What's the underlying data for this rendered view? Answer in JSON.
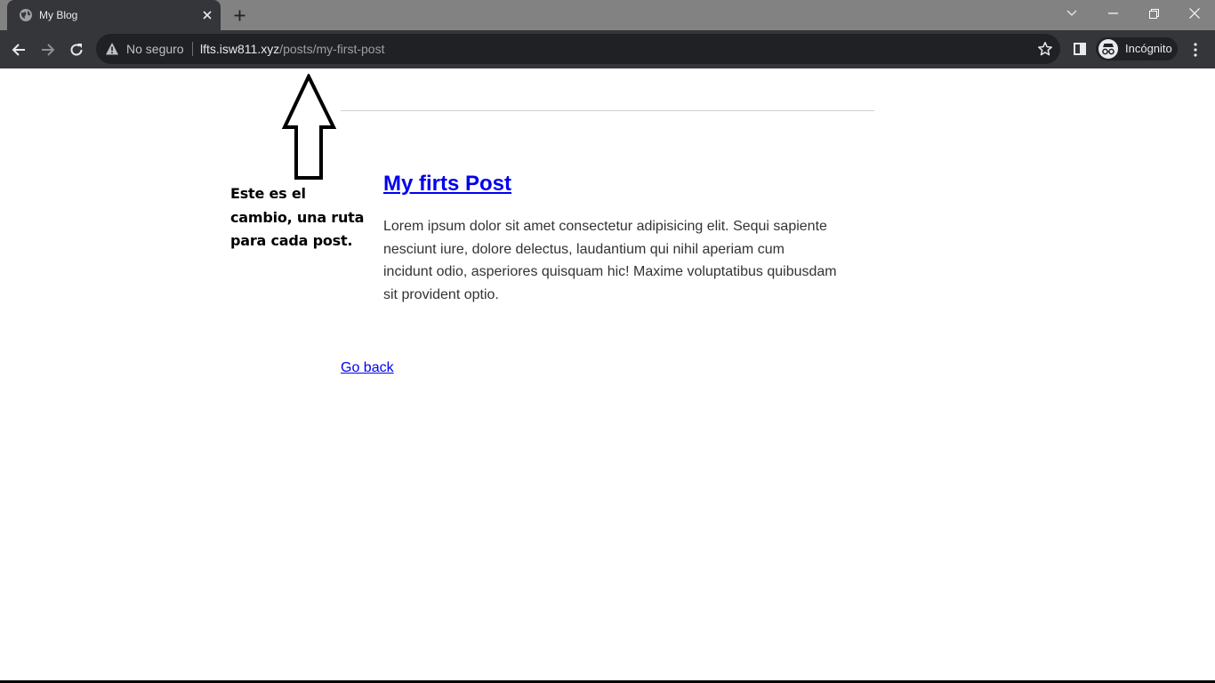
{
  "browser": {
    "tab": {
      "title": "My Blog"
    },
    "omnibox": {
      "security_label": "No seguro",
      "url_host": "lfts.isw811.xyz",
      "url_path": "/posts/my-first-post"
    },
    "profile": {
      "label": "Incógnito"
    },
    "colors": {
      "tabstrip": "#828282",
      "toolbar": "#35363a",
      "omnibox": "#202124"
    }
  },
  "page": {
    "annotation": {
      "line1": "Este es el",
      "line2": "cambio, una ruta",
      "line3": "para cada post."
    },
    "post": {
      "title": "My firts Post",
      "body": "Lorem ipsum dolor sit amet consectetur adipisicing elit. Sequi sapiente nesciunt iure, dolore delectus, laudantium qui nihil aperiam cum incidunt odio, asperiores quisquam hic! Maxime voluptatibus quibusdam sit provident optio."
    },
    "go_back_label": "Go back",
    "colors": {
      "link": "#0000ee",
      "body_text": "#333333"
    }
  },
  "icons": {
    "tab_favicon": "globe-icon",
    "tab_close": "close-icon",
    "new_tab": "plus-icon",
    "back": "arrow-left-icon",
    "forward": "arrow-right-icon",
    "reload": "reload-icon",
    "security": "warning-icon",
    "bookmark": "star-icon",
    "side_panel": "side-panel-icon",
    "incognito": "incognito-icon",
    "menu": "kebab-menu-icon"
  }
}
